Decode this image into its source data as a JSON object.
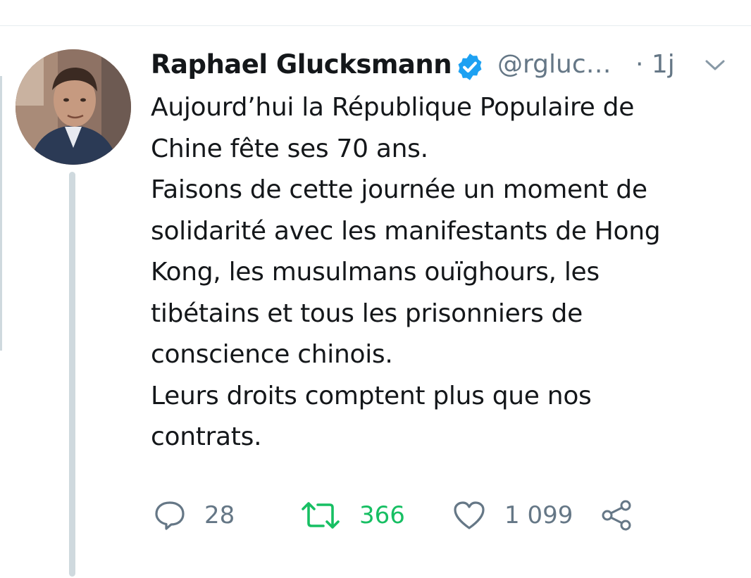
{
  "tweet": {
    "author_name": "Raphael Glucksmann",
    "handle": "@rgluc…",
    "time": "· 1j",
    "lines": [
      "Aujourd’hui la République Populaire de",
      "Chine fête ses 70 ans.",
      "Faisons de cette journée un moment de",
      "solidarité avec les manifestants de Hong",
      "Kong, les musulmans ouïghours, les",
      "tibétains et tous les prisonniers de",
      "conscience chinois.",
      "Leurs droits comptent plus que nos",
      "contrats."
    ]
  },
  "actions": {
    "reply_count": "28",
    "retweet_count": "366",
    "like_count": "1 099"
  },
  "icons": {
    "verified": "verified-badge-icon",
    "chevron": "chevron-down-icon",
    "reply": "reply-icon",
    "retweet": "retweet-icon",
    "like": "heart-icon",
    "share": "share-icon"
  },
  "colors": {
    "verified_blue": "#1da1f2",
    "secondary_text": "#657786",
    "retweet_green": "#17bf63",
    "thread_line": "#cfd9de"
  }
}
